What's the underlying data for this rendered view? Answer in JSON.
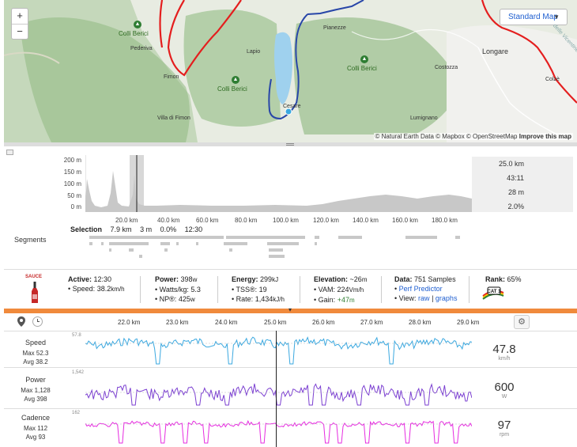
{
  "map": {
    "zoom_in": "+",
    "zoom_out": "−",
    "style_select": "Standard Map",
    "labels": {
      "colli_berici_1": "Colli Berici",
      "colli_berici_2": "Colli Berici",
      "colli_berici_3": "Colli Berici",
      "pederiva": "Pederiva",
      "fimon": "Fimon",
      "lapio": "Lapio",
      "villa_fimon": "Villa di Fimon",
      "pianezze": "Pianezze",
      "costozza": "Costozza",
      "longare": "Longare",
      "lumignano": "Lumignano",
      "colze": "Colzè",
      "cesare": "Cesare",
      "road": "delle Vicentine"
    },
    "attribution": "© Natural Earth Data © Mapbox © OpenStreetMap",
    "improve": "Improve this map"
  },
  "elevation": {
    "y_ticks": [
      "200 m",
      "150 m",
      "100 m",
      "50 m",
      "0 m"
    ],
    "x_ticks": [
      "20.0 km",
      "40.0 km",
      "60.0 km",
      "80.0 km",
      "100.0 km",
      "120.0 km",
      "140.0 km",
      "160.0 km",
      "180.0 km"
    ],
    "stats": [
      "25.0 km",
      "43:11",
      "28 m",
      "2.0%"
    ],
    "selection": {
      "label": "Selection",
      "distance": "7.9 km",
      "elev": "3 m",
      "grade": "0.0%",
      "time": "12:30"
    },
    "segments_label": "Segments"
  },
  "sauce": {
    "logo": "SAUCE",
    "active": {
      "label": "Active:",
      "value": "12:30",
      "speed_label": "Speed:",
      "speed": "38.2",
      "speed_unit": "km/h"
    },
    "power": {
      "label": "Power:",
      "value": "398",
      "unit": "w",
      "wkg_label": "Watts/kg:",
      "wkg": "5.3",
      "np_label": "NP®:",
      "np": "425",
      "np_unit": "w"
    },
    "energy": {
      "label": "Energy:",
      "value": "299",
      "unit": "kJ",
      "tss_label": "TSS®:",
      "tss": "19",
      "rate_label": "Rate:",
      "rate": "1,434",
      "rate_unit": "kJ/h"
    },
    "elevation": {
      "label": "Elevation:",
      "value": "~26",
      "unit": "m",
      "vam_label": "VAM:",
      "vam": "224",
      "vam_unit": "Vm/h",
      "gain_label": "Gain:",
      "gain": "+47",
      "gain_unit": "m"
    },
    "data": {
      "label": "Data:",
      "value": "751 Samples",
      "perf": "Perf Predictor",
      "view_label": "View:",
      "raw": "raw",
      "pipe": "|",
      "graphs": "graphs"
    },
    "rank": {
      "label": "Rank:",
      "value": "65%",
      "badge": "CAT 1"
    }
  },
  "graphs": {
    "x_ticks": [
      "22.0 km",
      "23.0 km",
      "24.0 km",
      "25.0 km",
      "26.0 km",
      "27.0 km",
      "28.0 km",
      "29.0 km"
    ],
    "rows": [
      {
        "title": "Speed",
        "max_label": "Max",
        "max": "52.3",
        "avg_label": "Avg",
        "avg": "38.2",
        "value": "47.8",
        "unit": "km/h",
        "scale_top": "57.8",
        "color": "#3aa8e0"
      },
      {
        "title": "Power",
        "max_label": "Max",
        "max": "1,128",
        "avg_label": "Avg",
        "avg": "398",
        "value": "600",
        "unit": "W",
        "scale_top": "1,542",
        "color": "#7b3fd1"
      },
      {
        "title": "Cadence",
        "max_label": "Max",
        "max": "112",
        "avg_label": "Avg",
        "avg": "93",
        "value": "97",
        "unit": "rpm",
        "scale_top": "162",
        "color": "#e62be0"
      }
    ]
  }
}
